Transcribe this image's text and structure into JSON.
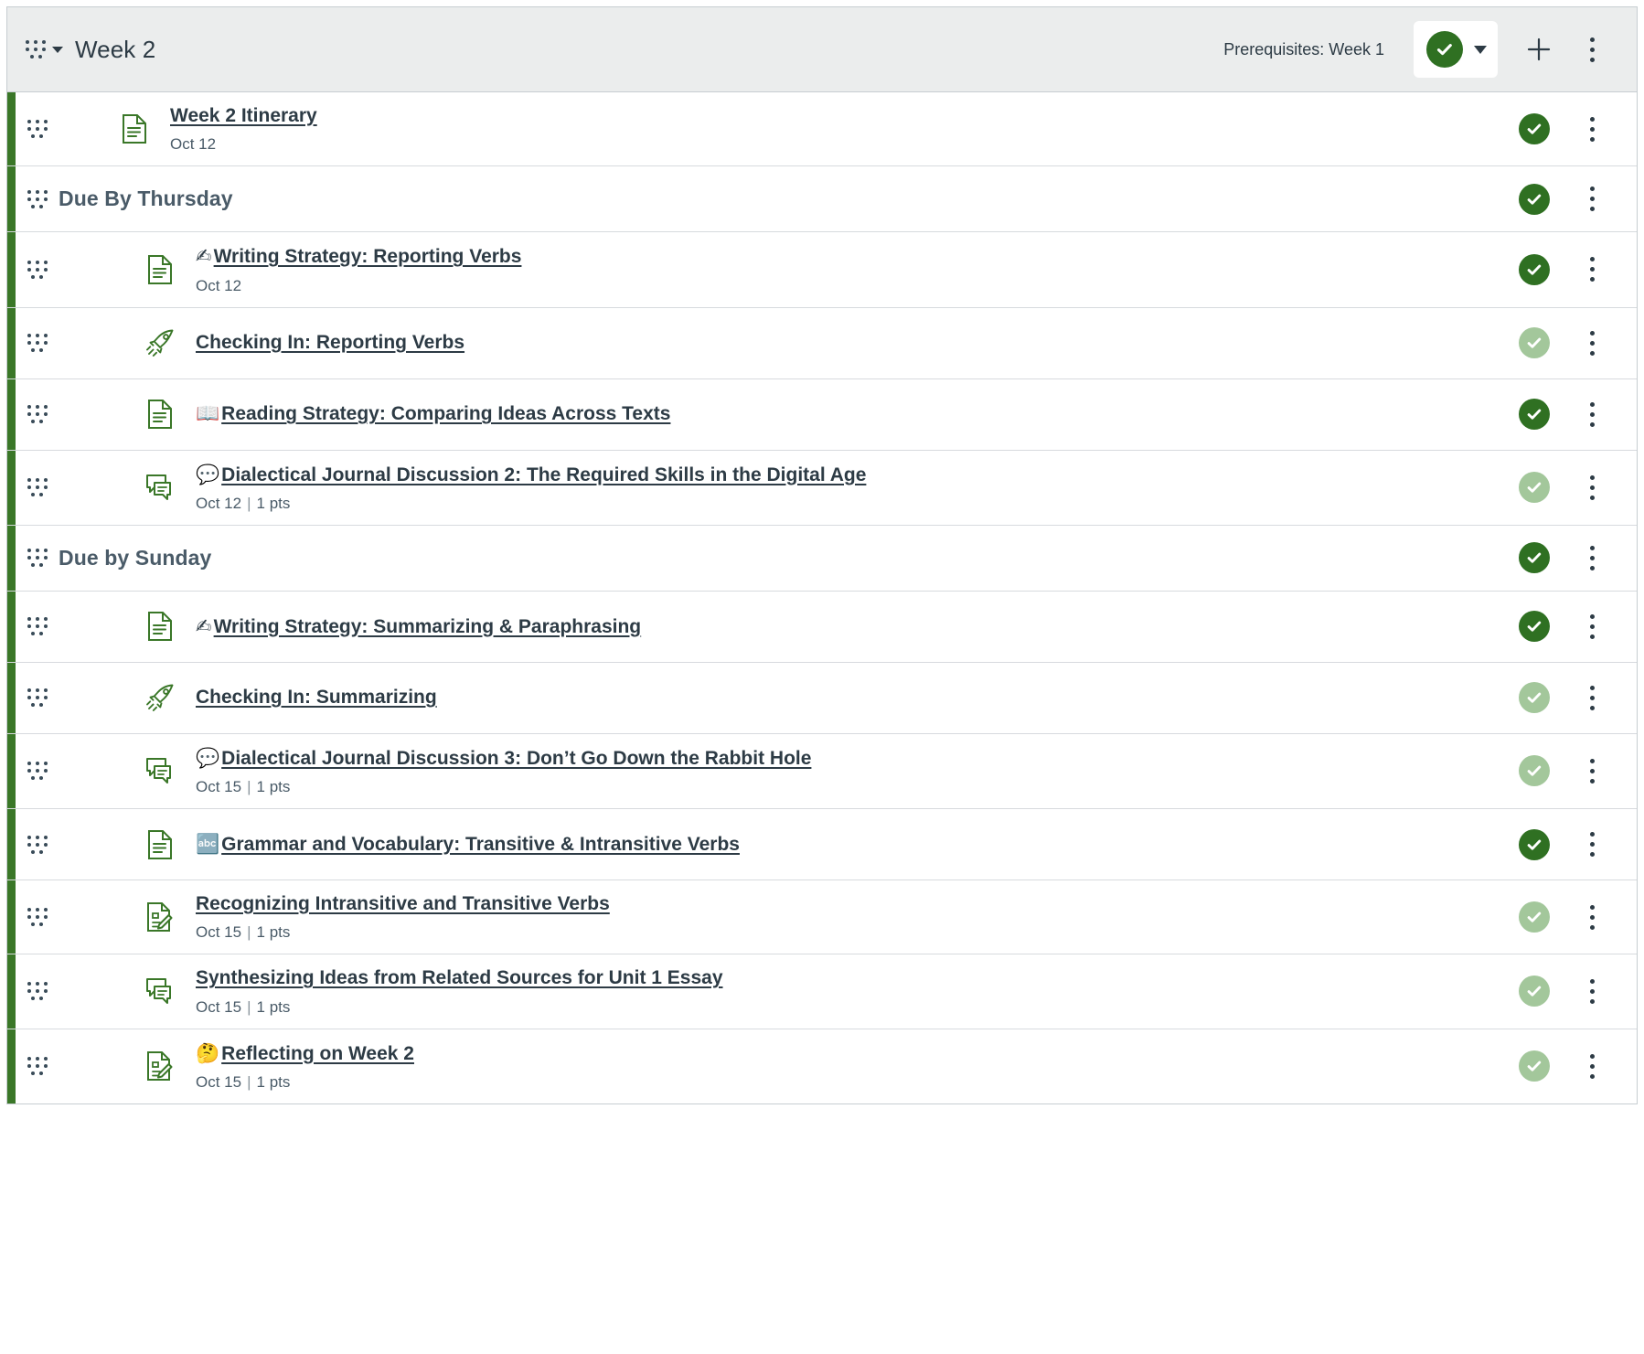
{
  "module": {
    "title": "Week 2",
    "prerequisites_label": "Prerequisites: Week 1",
    "publish_state": "published",
    "add_label": "+",
    "colors": {
      "published_green": "#2f7022",
      "dim_green": "#a3c79b",
      "rail_green": "#3a7728",
      "header_bg": "#ebeded",
      "text_dark": "#2d3b45",
      "text_muted": "#4a5b68"
    }
  },
  "rows": [
    {
      "kind": "item",
      "indent": 1,
      "icon": "page-document-icon",
      "emoji": "",
      "title": "Week 2 Itinerary",
      "meta_date": "Oct 12",
      "meta_points": "",
      "publish": "published"
    },
    {
      "kind": "text-header",
      "indent": 0,
      "icon": "",
      "emoji": "",
      "title": "Due By Thursday",
      "meta_date": "",
      "meta_points": "",
      "publish": "published"
    },
    {
      "kind": "item",
      "indent": 2,
      "icon": "page-document-icon",
      "emoji": "✍",
      "title": "Writing Strategy: Reporting Verbs",
      "meta_date": "Oct 12",
      "meta_points": "",
      "publish": "published"
    },
    {
      "kind": "item",
      "indent": 2,
      "icon": "rocket-external-tool-icon",
      "emoji": "",
      "title": "Checking In: Reporting Verbs",
      "meta_date": "",
      "meta_points": "",
      "publish": "dim"
    },
    {
      "kind": "item",
      "indent": 2,
      "icon": "page-document-icon",
      "emoji": "📖",
      "title": "Reading Strategy: Comparing Ideas Across Texts",
      "meta_date": "",
      "meta_points": "",
      "publish": "published"
    },
    {
      "kind": "item",
      "indent": 2,
      "icon": "discussion-icon",
      "emoji": "💬",
      "title": "Dialectical Journal Discussion 2: The Required Skills in the Digital Age",
      "meta_date": "Oct 12",
      "meta_points": "1 pts",
      "publish": "dim"
    },
    {
      "kind": "text-header",
      "indent": 0,
      "icon": "",
      "emoji": "",
      "title": "Due by Sunday",
      "meta_date": "",
      "meta_points": "",
      "publish": "published"
    },
    {
      "kind": "item",
      "indent": 2,
      "icon": "page-document-icon",
      "emoji": "✍",
      "title": "Writing Strategy: Summarizing & Paraphrasing",
      "meta_date": "",
      "meta_points": "",
      "publish": "published"
    },
    {
      "kind": "item",
      "indent": 2,
      "icon": "rocket-external-tool-icon",
      "emoji": "",
      "title": "Checking In: Summarizing",
      "meta_date": "",
      "meta_points": "",
      "publish": "dim"
    },
    {
      "kind": "item",
      "indent": 2,
      "icon": "discussion-icon",
      "emoji": "💬",
      "title": "Dialectical Journal Discussion 3: Don’t Go Down the Rabbit Hole",
      "meta_date": "Oct 15",
      "meta_points": "1 pts",
      "publish": "dim"
    },
    {
      "kind": "item",
      "indent": 2,
      "icon": "page-document-icon",
      "emoji": "🔤",
      "title": "Grammar and Vocabulary: Transitive & Intransitive Verbs",
      "meta_date": "",
      "meta_points": "",
      "publish": "published"
    },
    {
      "kind": "item",
      "indent": 2,
      "icon": "assignment-icon",
      "emoji": "",
      "title": "Recognizing Intransitive and Transitive Verbs",
      "meta_date": "Oct 15",
      "meta_points": "1 pts",
      "publish": "dim"
    },
    {
      "kind": "item",
      "indent": 2,
      "icon": "discussion-icon",
      "emoji": "",
      "title": "Synthesizing Ideas from Related Sources for Unit 1 Essay",
      "meta_date": "Oct 15",
      "meta_points": "1 pts",
      "publish": "dim"
    },
    {
      "kind": "item",
      "indent": 2,
      "icon": "assignment-icon",
      "emoji": "🤔",
      "title": "Reflecting on Week 2",
      "meta_date": "Oct 15",
      "meta_points": "1 pts",
      "publish": "dim"
    }
  ]
}
